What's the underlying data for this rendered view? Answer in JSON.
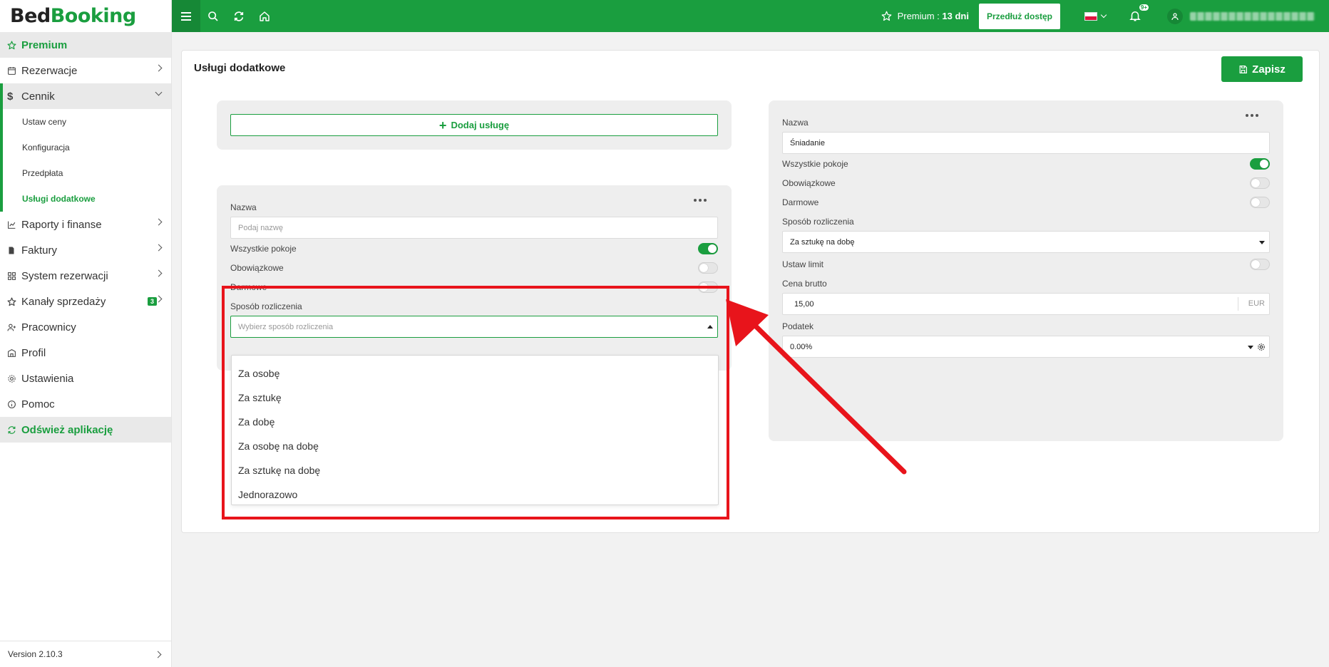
{
  "app": {
    "logo_part1": "Bed",
    "logo_part2": "Booking"
  },
  "sidebar": {
    "premium": "Premium",
    "items": [
      {
        "label": "Rezerwacje"
      },
      {
        "label": "Cennik"
      },
      {
        "label": "Raporty i finanse"
      },
      {
        "label": "Faktury"
      },
      {
        "label": "System rezerwacji"
      },
      {
        "label": "Kanały sprzedaży",
        "badge": "3"
      },
      {
        "label": "Pracownicy"
      },
      {
        "label": "Profil"
      },
      {
        "label": "Ustawienia"
      },
      {
        "label": "Pomoc"
      }
    ],
    "subitems": [
      {
        "label": "Ustaw ceny"
      },
      {
        "label": "Konfiguracja"
      },
      {
        "label": "Przedpłata"
      },
      {
        "label": "Usługi dodatkowe"
      }
    ],
    "refresh": "Odśwież aplikację",
    "version": "Version 2.10.3"
  },
  "topbar": {
    "premium_label": "Premium : ",
    "premium_days": "13 dni",
    "extend_button": "Przedłuż dostęp",
    "notif_badge": "9+"
  },
  "main": {
    "title": "Usługi dodatkowe",
    "save_button": "Zapisz",
    "add_service_button": "Dodaj usługę"
  },
  "new_service": {
    "name_label": "Nazwa",
    "name_placeholder": "Podaj nazwę",
    "all_rooms_label": "Wszystkie pokoje",
    "all_rooms_on": true,
    "mandatory_label": "Obowiązkowe",
    "mandatory_on": false,
    "free_label": "Darmowe",
    "free_on": false,
    "billing_label": "Sposób rozliczenia",
    "billing_placeholder": "Wybierz sposób rozliczenia",
    "billing_options": [
      "Za osobę",
      "Za sztukę",
      "Za dobę",
      "Za osobę na dobę",
      "Za sztukę na dobę",
      "Jednorazowo"
    ]
  },
  "existing_service": {
    "name_label": "Nazwa",
    "name_value": "Śniadanie",
    "all_rooms_label": "Wszystkie pokoje",
    "all_rooms_on": true,
    "mandatory_label": "Obowiązkowe",
    "mandatory_on": false,
    "free_label": "Darmowe",
    "free_on": false,
    "billing_label": "Sposób rozliczenia",
    "billing_value": "Za sztukę na dobę",
    "limit_label": "Ustaw limit",
    "limit_on": false,
    "price_label": "Cena brutto",
    "price_value": "15,00",
    "currency": "EUR",
    "tax_label": "Podatek",
    "tax_value": "0.00%"
  },
  "colors": {
    "brand_green": "#1a9e3f",
    "annotation_red": "#e8141b"
  }
}
